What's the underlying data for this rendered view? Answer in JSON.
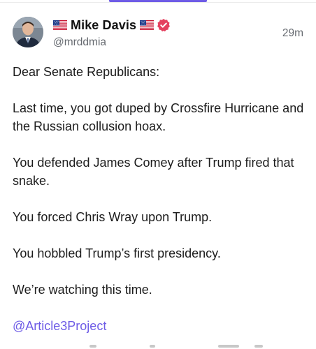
{
  "post": {
    "author": {
      "display_name": "Mike Davis",
      "handle": "@mrddmia",
      "flag_icon": "us-flag-icon",
      "verified_icon": "verified-badge-icon",
      "verified_color": "#e4405f"
    },
    "timestamp": "29m",
    "paragraphs": [
      "Dear Senate Republicans:",
      "Last time, you got duped by Crossfire Hurricane and the Russian collusion hoax.",
      "You defended James Comey after Trump fired that snake.",
      "You forced Chris Wray upon Trump.",
      "You hobbled Trump’s first presidency.",
      "We’re watching this time."
    ],
    "mention": "@Article3Project"
  },
  "colors": {
    "accent": "#6e5ce6",
    "text": "#1c1c1c",
    "muted": "#666a70"
  }
}
